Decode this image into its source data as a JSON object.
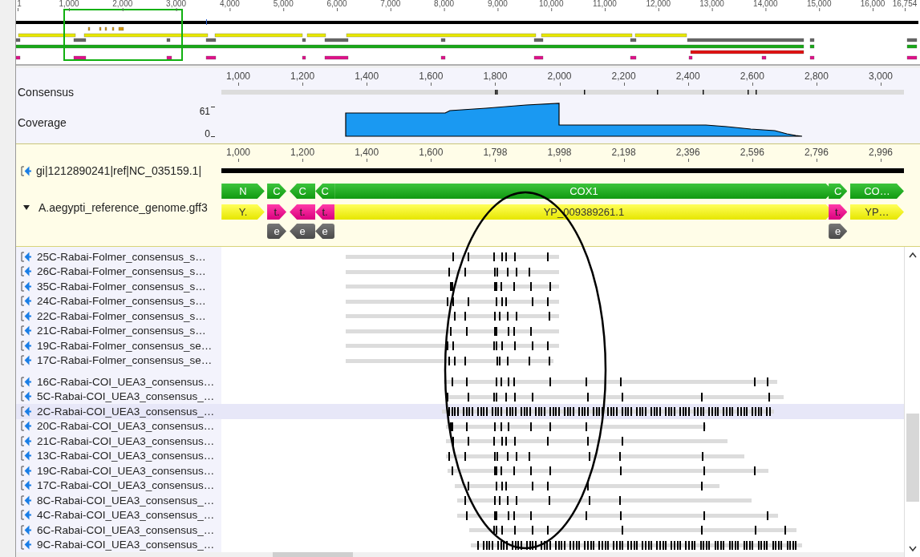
{
  "overview": {
    "ruler": [
      "1",
      "1,000",
      "2,000",
      "3,000",
      "4,000",
      "5,000",
      "6,000",
      "7,000",
      "8,000",
      "9,000",
      "10,000",
      "11,000",
      "12,000",
      "13,000",
      "14,000",
      "15,000",
      "16,000",
      "16,754"
    ]
  },
  "consensus_panel": {
    "ruler": [
      "1,000",
      "1,200",
      "1,400",
      "1,600",
      "1,800",
      "2,000",
      "2,200",
      "2,400",
      "2,600",
      "2,800",
      "3,000"
    ],
    "consensus_label": "Consensus",
    "coverage_label": "Coverage",
    "coverage_max": "61",
    "coverage_min": "0"
  },
  "reference_panel": {
    "ruler": [
      "1,000",
      "1,200",
      "1,400",
      "1,600",
      "1,798",
      "1,998",
      "2,198",
      "2,396",
      "2,596",
      "2,796",
      "2,996"
    ],
    "sequence_name": "gi|1212890241|ref|NC_035159.1|",
    "annotation_track": {
      "name": "A.aegypti_reference_genome.gff3",
      "expanded": true
    },
    "annotations": [
      {
        "label": "N",
        "kind": "gene"
      },
      {
        "label": "C",
        "kind": "gene"
      },
      {
        "label": "C",
        "kind": "gene"
      },
      {
        "label": "C",
        "kind": "gene"
      },
      {
        "label": "COX1",
        "kind": "gene"
      },
      {
        "label": "C",
        "kind": "gene"
      },
      {
        "label": "CO…",
        "kind": "gene"
      },
      {
        "label": "Y.",
        "kind": "cds"
      },
      {
        "label": "t.",
        "kind": "trna"
      },
      {
        "label": "t.",
        "kind": "trna"
      },
      {
        "label": "t.",
        "kind": "trna"
      },
      {
        "label": "YP_009389261.1",
        "kind": "cds"
      },
      {
        "label": "t.",
        "kind": "trna"
      },
      {
        "label": "YP…",
        "kind": "cds"
      },
      {
        "label": "e",
        "kind": "exon"
      },
      {
        "label": "e",
        "kind": "exon"
      },
      {
        "label": "e",
        "kind": "exon"
      },
      {
        "label": "e",
        "kind": "exon"
      }
    ]
  },
  "read_groups": [
    {
      "reads": [
        {
          "name": "25C-Rabai-Folmer_consensus_s…",
          "selected": false
        },
        {
          "name": "26C-Rabai-Folmer_consensus_s…",
          "selected": false
        },
        {
          "name": "35C-Rabai-Folmer_consensus_s…",
          "selected": false
        },
        {
          "name": "24C-Rabai-Folmer_consensus_s…",
          "selected": false
        },
        {
          "name": "22C-Rabai-Folmer_consensus_s…",
          "selected": false
        },
        {
          "name": "21C-Rabai-Folmer_consensus_s…",
          "selected": false
        },
        {
          "name": "19C-Rabai-Folmer_consensus_se…",
          "selected": false
        },
        {
          "name": "17C-Rabai-Folmer_consensus_se…",
          "selected": false
        }
      ]
    },
    {
      "reads": [
        {
          "name": "16C-Rabai-COI_UEA3_consensus…",
          "selected": false
        },
        {
          "name": "5C-Rabai-COI_UEA3_consensus_…",
          "selected": false
        },
        {
          "name": "2C-Rabai-COI_UEA3_consensus_…",
          "selected": true
        },
        {
          "name": "20C-Rabai-COI_UEA3_consensus…",
          "selected": false
        },
        {
          "name": "21C-Rabai-COI_UEA3_consensus…",
          "selected": false
        },
        {
          "name": "13C-Rabai-COI_UEA3_consensus…",
          "selected": false
        },
        {
          "name": "19C-Rabai-COI_UEA3_consensus…",
          "selected": false
        },
        {
          "name": "17C-Rabai-COI_UEA3_consensus…",
          "selected": false
        },
        {
          "name": "8C-Rabai-COI_UEA3_consensus_…",
          "selected": false
        },
        {
          "name": "4C-Rabai-COI_UEA3_consensus_…",
          "selected": false
        },
        {
          "name": "6C-Rabai-COI_UEA3_consensus_…",
          "selected": false
        },
        {
          "name": "9C-Rabai-COI_UEA3_consensus_…",
          "selected": false
        }
      ]
    }
  ]
}
